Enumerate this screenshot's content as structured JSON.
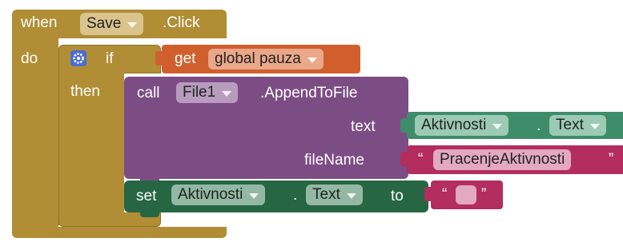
{
  "event": {
    "when_label": "when",
    "component": "Save",
    "event_name": ".Click",
    "do_label": "do"
  },
  "if_block": {
    "if_label": "if",
    "then_label": "then"
  },
  "condition": {
    "get_label": "get",
    "variable": "global pauza"
  },
  "call_block": {
    "call_label": "call",
    "component": "File1",
    "method": ".AppendToFile",
    "text_label": "text",
    "filename_label": "fileName"
  },
  "text_arg": {
    "component": "Aktivnosti",
    "dot": ".",
    "property": "Text"
  },
  "filename_arg": {
    "open_quote": "“",
    "value": "PracenjeAktivnosti",
    "close_quote": "”"
  },
  "set_block": {
    "set_label": "set",
    "component": "Aktivnosti",
    "dot": ".",
    "property": "Text",
    "to_label": "to"
  },
  "empty_text": {
    "open_quote": "“",
    "close_quote": "”"
  },
  "colors": {
    "control": "#b18e35",
    "variable": "#d05f2d",
    "procedure": "#7c4d84",
    "component": "#3f8c6a",
    "text": "#b32d5e",
    "setter": "#266643"
  },
  "icons": {
    "mutator": "gear-icon",
    "dropdown": "chevron-down-icon"
  }
}
